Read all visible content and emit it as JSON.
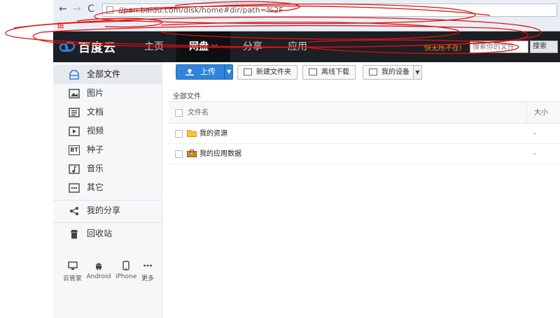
{
  "browser": {
    "address_text": "//pan.baidu.com/disk/home#dir/path=%2F",
    "back_glyph": "←",
    "forward_glyph": "→",
    "reload_glyph": "C"
  },
  "app": {
    "logo_text": "百度云",
    "nav": [
      {
        "label": "主页",
        "active": false
      },
      {
        "label": "网盘",
        "active": true
      },
      {
        "label": "分享",
        "active": false
      },
      {
        "label": "应用",
        "active": false
      }
    ],
    "nav_caret": "﹀",
    "promo_text": "快无所不在!",
    "search_placeholder": "搜索你的文件",
    "search_button": "搜索"
  },
  "sidebar": {
    "items": [
      {
        "label": "全部文件",
        "icon": "all-files-icon"
      },
      {
        "label": "图片",
        "icon": "image-icon"
      },
      {
        "label": "文档",
        "icon": "document-icon"
      },
      {
        "label": "视频",
        "icon": "video-icon"
      },
      {
        "label": "种子",
        "icon": "torrent-icon"
      },
      {
        "label": "音乐",
        "icon": "music-icon"
      },
      {
        "label": "其它",
        "icon": "other-icon"
      },
      {
        "label": "我的分享",
        "icon": "share-icon"
      },
      {
        "label": "回收站",
        "icon": "trash-icon"
      }
    ],
    "torrent_badge": "BT",
    "devices": [
      {
        "label": "云管家",
        "icon": "monitor-icon"
      },
      {
        "label": "Android",
        "icon": "android-icon"
      },
      {
        "label": "iPhone",
        "icon": "iphone-icon"
      },
      {
        "label": "更多",
        "icon": "more-icon"
      }
    ]
  },
  "toolbar": {
    "upload_label": "上传",
    "new_folder_label": "新建文件夹",
    "offline_download_label": "离线下载",
    "my_devices_label": "我的设备"
  },
  "content": {
    "breadcrumb": "全部文件",
    "columns": {
      "name": "文件名",
      "size": "大小"
    },
    "files": [
      {
        "name": "我的资源",
        "size": "-",
        "type": "folder"
      },
      {
        "name": "我的应用数据",
        "size": "-",
        "type": "app-folder"
      }
    ]
  },
  "colors": {
    "accent": "#2f83d8",
    "top_bar": "#1c1f24",
    "promo": "#f08a1c",
    "scribble": "#e01010"
  }
}
